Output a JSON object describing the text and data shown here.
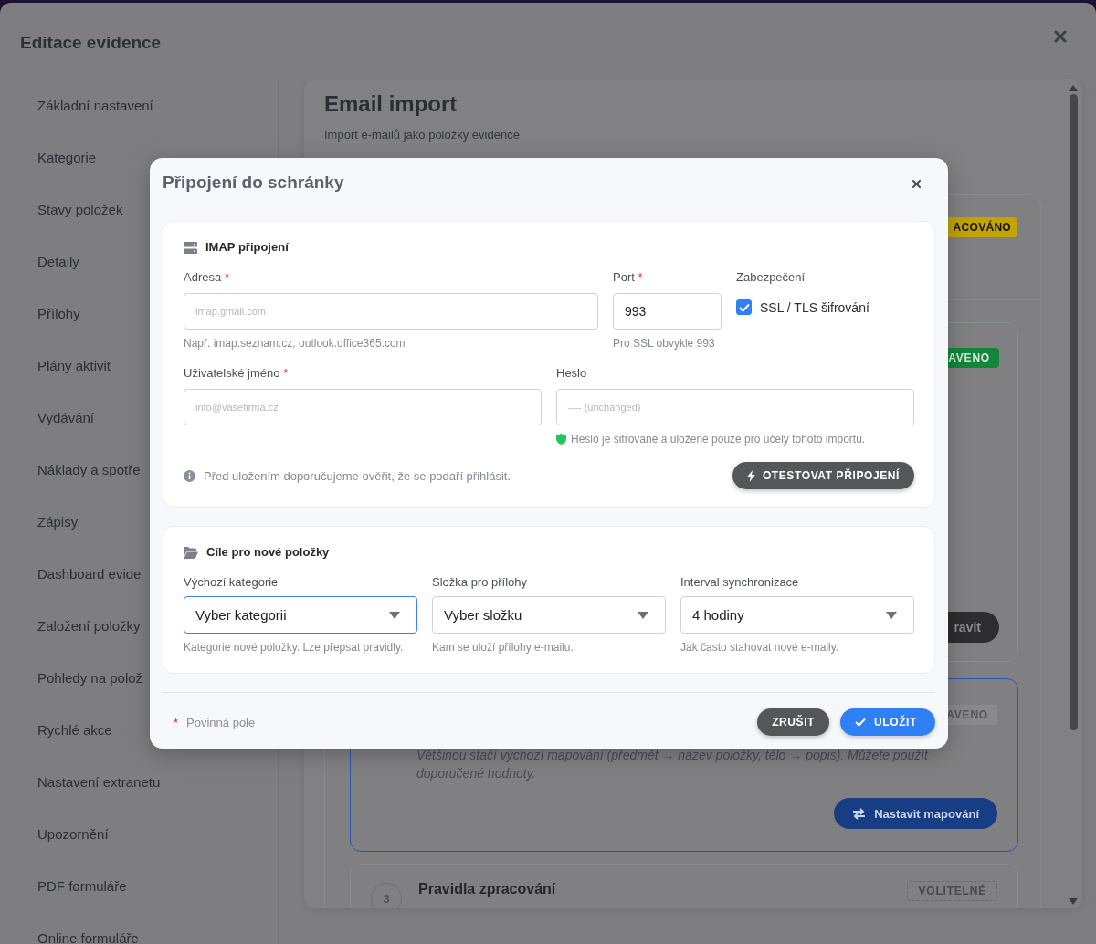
{
  "backdrop": {
    "title": "Editace evidence",
    "sidebar": {
      "items": [
        "Základní nastavení",
        "Kategorie",
        "Stavy položek",
        "Detaily",
        "Přílohy",
        "Plány aktivit",
        "Vydávání",
        "Náklady a spotře",
        "Zápisy",
        "Dashboard evide",
        "Založení položky",
        "Pohledy na polož",
        "Rychlé akce",
        "Nastavení extranetu",
        "Upozornění",
        "PDF formuláře",
        "Online formuláře"
      ]
    }
  },
  "main": {
    "title": "Email import",
    "subtitle": "Import e-mailů jako položky evidence",
    "status_badge": {
      "text": "ACOVÁNO",
      "color": "#c2a300"
    },
    "steps": [
      {
        "kind": "plain",
        "badge": {
          "text": "AVENO",
          "color": "#12863a"
        },
        "button": "ravit"
      },
      {
        "kind": "highlighted",
        "badge": {
          "text": "AVENO",
          "color": "#8a8a8c"
        },
        "description": "Většinou stačí výchozí mapování (předmět → název položky, tělo → popis). Můžete použít doporučené hodnoty.",
        "button": "Nastavit mapování"
      },
      {
        "kind": "numbered",
        "number": "3",
        "title": "Pravidla zpracování",
        "badge": {
          "text": "VOLITELNÉ"
        }
      }
    ]
  },
  "modal": {
    "title": "Připojení do schránky",
    "connection": {
      "title": "IMAP připojení",
      "address": {
        "label": "Adresa",
        "required_mark": "*",
        "placeholder": "imap.gmail.com",
        "hint": "Např. imap.seznam.cz, outlook.office365.com"
      },
      "port": {
        "label": "Port",
        "required_mark": "*",
        "value": "993",
        "hint": "Pro SSL obvykle 993"
      },
      "security": {
        "label": "Zabezpečení",
        "option": "SSL / TLS šifrování",
        "checked": true
      },
      "username": {
        "label": "Uživatelské jméno",
        "required_mark": "*",
        "placeholder": "info@vasefirma.cz"
      },
      "password": {
        "label": "Heslo",
        "placeholder": "---- (unchanged)",
        "hint": "Heslo je šifrované a uložené pouze pro účely tohoto importu."
      },
      "note": "Před uložením doporučujeme ověřit, že se podaří přihlásit.",
      "test_button": "OTESTOVAT PŘIPOJENÍ"
    },
    "targets": {
      "title": "Cíle pro nové položky",
      "selects": [
        {
          "label": "Výchozí kategorie",
          "value": "Vyber kategorii",
          "hint": "Kategorie nové položky. Lze přepsat pravidly.",
          "focused": true
        },
        {
          "label": "Složka pro přílohy",
          "value": "Vyber složku",
          "hint": "Kam se uloží přílohy e-mailu.",
          "focused": false
        },
        {
          "label": "Interval synchronizace",
          "value": "4 hodiny",
          "hint": "Jak často stahovat nové e-maily.",
          "focused": false
        }
      ]
    },
    "footer": {
      "required_mark": "*",
      "legend": "Povinná pole",
      "cancel": "ZRUŠIT",
      "save": "ULOŽIT"
    }
  }
}
